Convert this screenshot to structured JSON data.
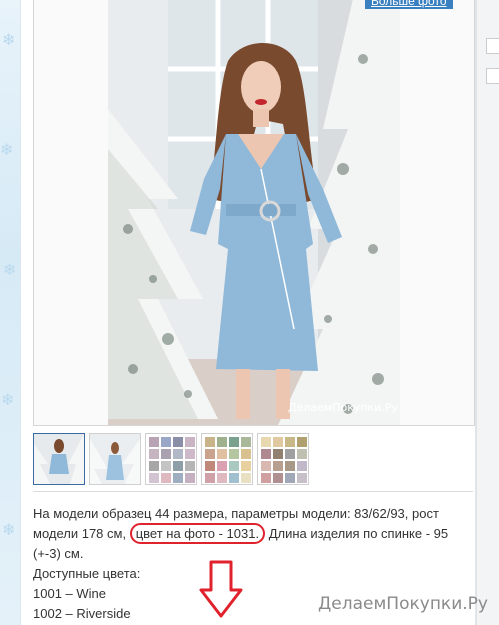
{
  "header": {
    "more_photos_label": "Больше фото"
  },
  "photo": {
    "watermark": "ДелаемПокупки.Ру",
    "alt": "model-in-blue-wrap-dress"
  },
  "thumbnails": [
    {
      "name": "thumb-photo-1",
      "kind": "photo"
    },
    {
      "name": "thumb-photo-2",
      "kind": "photo"
    },
    {
      "name": "thumb-swatches-1",
      "kind": "swatches",
      "colors": [
        "#b7a3b3",
        "#9aa6c7",
        "#8a8fa7",
        "#c9b4c4",
        "#c6b5c0",
        "#a9a0b0",
        "#b2b7c8",
        "#cdb9c9",
        "#a6a6a6",
        "#c4c4c4",
        "#8f9fa9",
        "#b5b5b5",
        "#d2c4d0",
        "#e0b8c0",
        "#9eaec0",
        "#c4b0c0"
      ]
    },
    {
      "name": "thumb-swatches-2",
      "kind": "swatches",
      "colors": [
        "#c9b48a",
        "#9fb08c",
        "#7aa08e",
        "#a8b898",
        "#caa38d",
        "#e0c0a0",
        "#b4c6a0",
        "#d8c090",
        "#c08878",
        "#d8a0b0",
        "#a8c8c0",
        "#e8d0a0",
        "#d0a0a8",
        "#e0b8c0",
        "#a0c0d0",
        "#e8e0c0"
      ]
    },
    {
      "name": "thumb-swatches-3",
      "kind": "swatches",
      "colors": [
        "#e8d8b0",
        "#e0c8a0",
        "#c8b888",
        "#b0a070",
        "#b08890",
        "#908070",
        "#a0a0a0",
        "#c0c0b0",
        "#d8b8b0",
        "#b8a090",
        "#a89888",
        "#c0b8c8",
        "#d0a0a0",
        "#b09090",
        "#a0a8b8",
        "#c8c0c8"
      ]
    }
  ],
  "description": {
    "line1": "На модели образец 44 размера, параметры модели: 83/62/93, рост",
    "line2_before": "модели 178 см,",
    "line2_highlight": "цвет на фото - 1031.",
    "line2_after": "Длина изделия по спинке - 95",
    "line3": "(+-3) см.",
    "colors_heading": "Доступные цвета:",
    "color_items": [
      "1001 – Wine",
      "1002 – Riverside"
    ]
  },
  "watermark_bottom": "ДелаемПокупки.Ру",
  "colors": {
    "highlight": "#e0222c",
    "dress": "#8fb8d9",
    "link": "#3a7fc0"
  }
}
